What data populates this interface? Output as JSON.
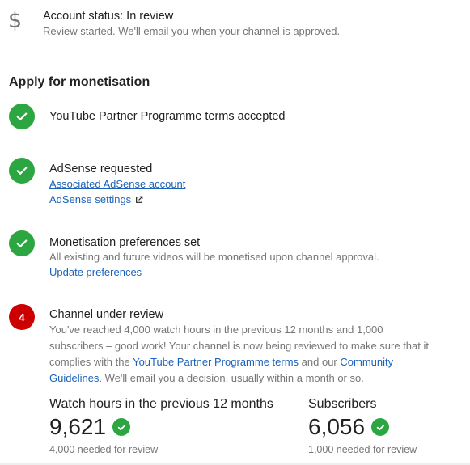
{
  "account_status": {
    "icon": "dollar-icon",
    "symbol": "$",
    "title": "Account status: In review",
    "subtitle": "Review started. We'll email you when your channel is approved."
  },
  "section_title": "Apply for monetisation",
  "colors": {
    "done": "#2ba640",
    "current": "#cc0000",
    "link": "#1c62b9",
    "muted": "#757575"
  },
  "steps": [
    {
      "state": "done",
      "icon": "check-icon",
      "title": "YouTube Partner Programme terms accepted"
    },
    {
      "state": "done",
      "icon": "check-icon",
      "title": "AdSense requested",
      "link1": "Associated AdSense account",
      "link2": "AdSense settings",
      "link2_icon": "external-link-icon"
    },
    {
      "state": "done",
      "icon": "check-icon",
      "title": "Monetisation preferences set",
      "text": "All existing and future videos will be monetised upon channel approval.",
      "link1": "Update preferences"
    },
    {
      "state": "current",
      "number": "4",
      "title": "Channel under review",
      "text_part1": "You've reached 4,000 watch hours in the previous 12 months and 1,000 subscribers – good work! Your channel is now being reviewed to make sure that it complies with the ",
      "terms_link": "YouTube Partner Programme terms",
      "text_part2": " and our ",
      "guidelines_link": "Community Guidelines",
      "text_part3": ". We'll email you a decision, usually within a month or so."
    }
  ],
  "stats": [
    {
      "label": "Watch hours in the previous 12 months",
      "value": "9,621",
      "requirement": "4,000 needed for review",
      "icon": "check-icon"
    },
    {
      "label": "Subscribers",
      "value": "6,056",
      "requirement": "1,000 needed for review",
      "icon": "check-icon"
    }
  ]
}
